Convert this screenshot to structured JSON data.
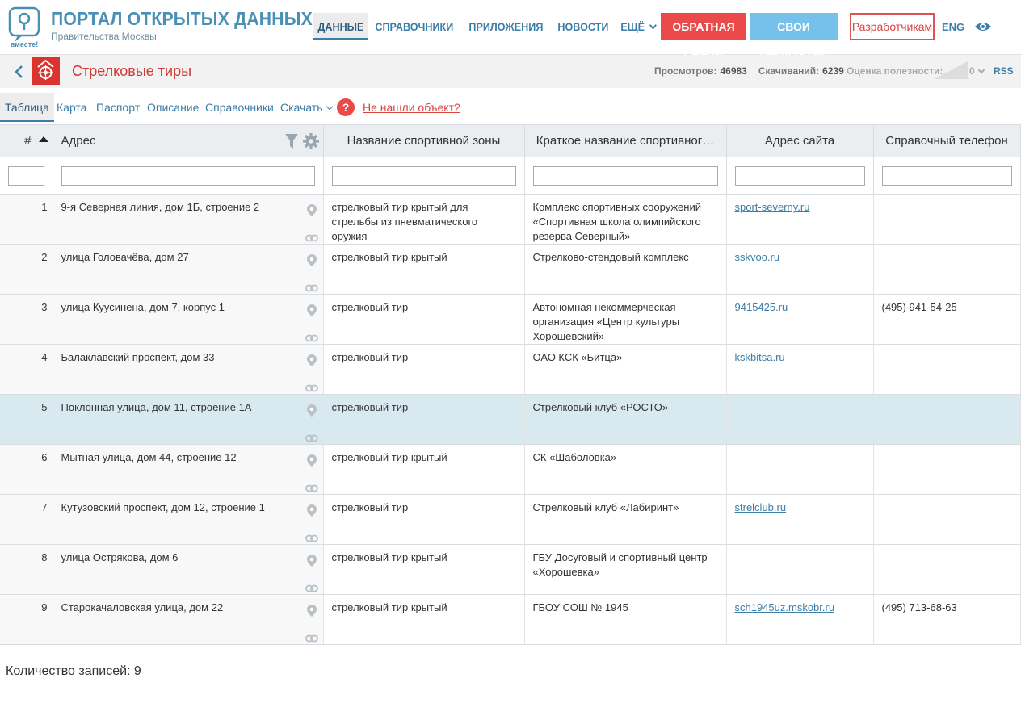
{
  "header": {
    "logo_text": "вместе!",
    "title": "ПОРТАЛ ОТКРЫТЫХ ДАННЫХ",
    "subtitle": "Правительства Москвы",
    "nav": [
      "ДАННЫЕ",
      "СПРАВОЧНИКИ",
      "ПРИЛОЖЕНИЯ",
      "НОВОСТИ",
      "ЕЩЁ"
    ],
    "feedback_btn": "ОБРАТНАЯ СВЯЗЬ",
    "products_btn": "СВОИ ПРОДУКТЫ!",
    "dev_btn": "Разработчикам",
    "lang": "ENG"
  },
  "dataset": {
    "title": "Стрелковые тиры",
    "views_label": "Просмотров:",
    "views": "46983",
    "downloads_label": "Скачиваний:",
    "downloads": "6239",
    "rating_label": "Оценка полезности:",
    "rating_value": "0",
    "rss": "RSS"
  },
  "tabs": [
    "Таблица",
    "Карта",
    "Паспорт",
    "Описание",
    "Справочники",
    "Скачать"
  ],
  "help_icon": "?",
  "not_found": "Не нашли объект?",
  "table": {
    "columns": [
      "#",
      "Адрес",
      "Название спортивной зоны",
      "Краткое название спортивног…",
      "Адрес сайта",
      "Справочный телефон"
    ],
    "rows": [
      {
        "n": "1",
        "addr": "9-я Северная линия, дом 1Б, строение 2",
        "zone": "стрелковый тир крытый для стрельбы из пневматического оружия",
        "short": "Комплекс спортивных сооружений «Спортивная школа олимпийского резерва Северный»",
        "site": "sport-severny.ru",
        "phone": ""
      },
      {
        "n": "2",
        "addr": "улица Головачёва, дом 27",
        "zone": "стрелковый тир крытый",
        "short": "Стрелково-стендовый комплекс",
        "site": "sskvoo.ru",
        "phone": ""
      },
      {
        "n": "3",
        "addr": "улица Куусинена, дом 7, корпус 1",
        "zone": "стрелковый тир",
        "short": "Автономная некоммерческая организация «Центр культуры Хорошевский»",
        "site": "9415425.ru",
        "phone": "(495) 941-54-25"
      },
      {
        "n": "4",
        "addr": "Балаклавский проспект, дом 33",
        "zone": "стрелковый тир",
        "short": "ОАО КСК «Битца»",
        "site": "kskbitsa.ru",
        "phone": ""
      },
      {
        "n": "5",
        "addr": "Поклонная улица, дом 11, строение 1А",
        "zone": "стрелковый тир",
        "short": "Стрелковый клуб «РОСТО»",
        "site": "",
        "phone": ""
      },
      {
        "n": "6",
        "addr": "Мытная улица, дом 44, строение 12",
        "zone": "стрелковый тир крытый",
        "short": "СК «Шаболовка»",
        "site": "",
        "phone": ""
      },
      {
        "n": "7",
        "addr": "Кутузовский проспект, дом 12, строение 1",
        "zone": "стрелковый тир",
        "short": "Стрелковый клуб «Лабиринт»",
        "site": "strelclub.ru",
        "phone": ""
      },
      {
        "n": "8",
        "addr": "улица Острякова, дом 6",
        "zone": "стрелковый тир крытый",
        "short": "ГБУ Досуговый и спортивный центр «Хорошевка»",
        "site": "",
        "phone": ""
      },
      {
        "n": "9",
        "addr": "Старокачаловская улица, дом 22",
        "zone": "стрелковый тир крытый",
        "short": "ГБОУ СОШ № 1945",
        "site": "sch1945uz.mskobr.ru",
        "phone": "(495) 713-68-63"
      }
    ]
  },
  "footer": {
    "count": "Количество записей: 9"
  }
}
